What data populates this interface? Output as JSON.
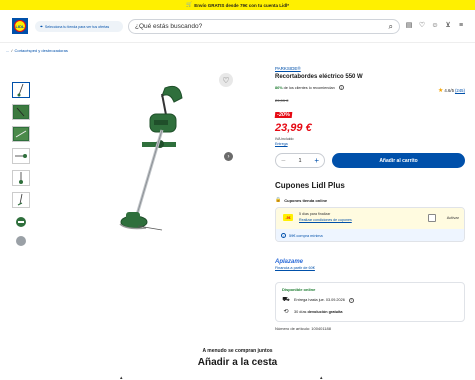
{
  "topbar": {
    "text": "Envío GRATIS desde 79€ con tu cuenta Lidl*"
  },
  "header": {
    "logo_text": "LIDL",
    "store_selector": "Selecciona tu tienda para ver tus ofertas",
    "search_placeholder": "¿Qué estás buscando?"
  },
  "breadcrumb": {
    "prefix": "...",
    "item": "Cortacésped y desbrozadoras"
  },
  "product": {
    "brand": "PARKSIDE®",
    "title": "Recortabordes eléctrico 550 W",
    "recommend_pct": "86%",
    "recommend_text": "de los clientes lo recomiendan",
    "rating": "4.6/5",
    "review_count": "(245)",
    "old_price": "29,99 €",
    "discount": "-20%",
    "price": "23,99 €",
    "iva": "IVA incluido",
    "entrega": "Entrega",
    "quantity": "1",
    "add_to_cart": "Añadir al carrito",
    "article_number": "Número de artículo: 100401188"
  },
  "coupons": {
    "title": "Cupones Lidl Plus",
    "subtitle": "Cupones tienda online",
    "badge": "-5€",
    "days_left": "5 días para finalizar",
    "conditions_link": "Realizar condiciones de cupones",
    "activate": "Activar",
    "minimum": "59€ compra mínima"
  },
  "financing": {
    "brand": "Aplazame",
    "text": "Financia a partir de 60€"
  },
  "availability": {
    "status": "Disponible online",
    "delivery": "Entrega hasta jue. 03.09.2026",
    "returns_prefix": "30 días ",
    "returns_bold": "devolución gratuita"
  },
  "bottom": {
    "subtitle": "A menudo se compran juntos",
    "title": "Añadir a la cesta"
  },
  "colors": {
    "brand_blue": "#0050aa",
    "lidl_yellow": "#fff000",
    "price_red": "#e60a14",
    "product_green": "#2f6f3c"
  }
}
